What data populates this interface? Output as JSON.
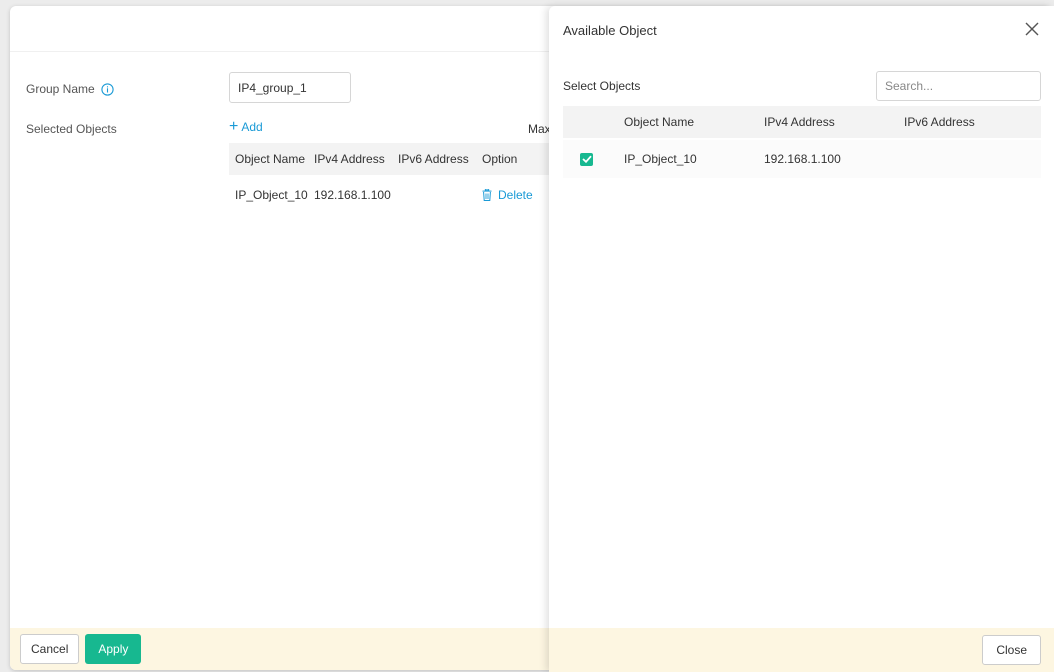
{
  "group_form": {
    "group_name_label": "Group Name",
    "group_name_value": "IP4_group_1",
    "selected_objects_label": "Selected Objects",
    "add_label": "Add",
    "max_text": "Max",
    "table": {
      "headers": [
        "Object Name",
        "IPv4 Address",
        "IPv6 Address",
        "Option"
      ],
      "rows": [
        {
          "object_name": "IP_Object_10",
          "ipv4": "192.168.1.100",
          "ipv6": "",
          "option": "Delete"
        }
      ]
    },
    "footer": {
      "cancel_label": "Cancel",
      "apply_label": "Apply"
    }
  },
  "drawer": {
    "title": "Available Object",
    "select_objects_label": "Select Objects",
    "search_placeholder": "Search...",
    "table": {
      "headers": [
        "Object Name",
        "IPv4 Address",
        "IPv6 Address"
      ],
      "rows": [
        {
          "checked": true,
          "object_name": "IP_Object_10",
          "ipv4": "192.168.1.100",
          "ipv6": ""
        }
      ]
    },
    "footer": {
      "close_label": "Close"
    }
  },
  "colors": {
    "accent_link": "#1a9ad6",
    "apply_green": "#17b890",
    "footer_bg": "#fdf6e1"
  }
}
